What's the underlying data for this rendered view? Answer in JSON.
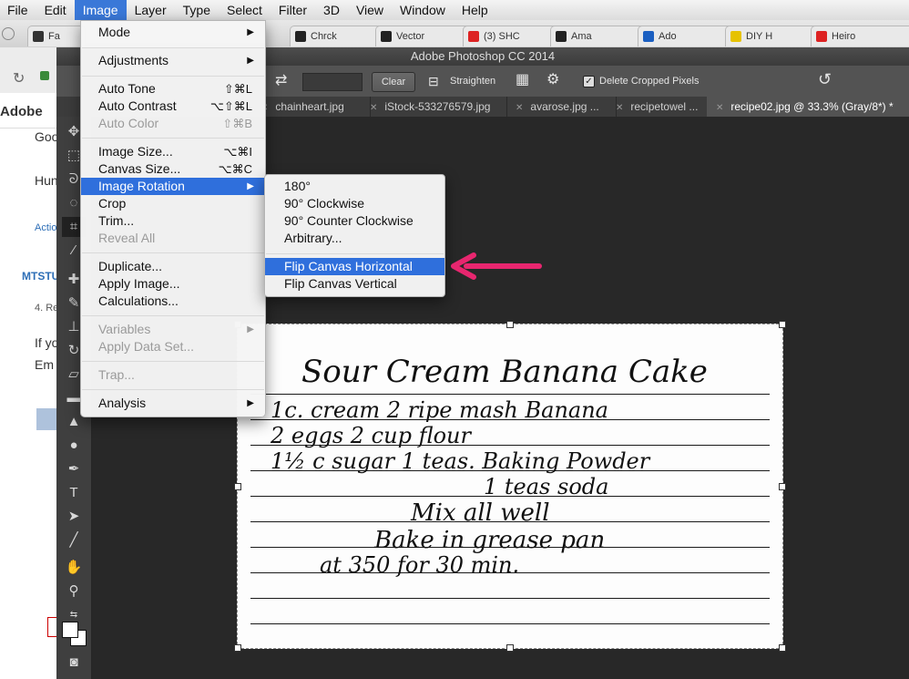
{
  "menubar": {
    "items": [
      "File",
      "Edit",
      "Image",
      "Layer",
      "Type",
      "Select",
      "Filter",
      "3D",
      "View",
      "Window",
      "Help"
    ],
    "active": "Image"
  },
  "browser": {
    "tabs": [
      "Fa",
      "Chrck",
      "Vector",
      "(3) SHC",
      "Ama",
      "Ado",
      "DIY H",
      "Heiro"
    ],
    "sidebar_texts": [
      "Adobe",
      "Goo",
      "Hun",
      "Actio",
      "MTSTU",
      "4. Re",
      "If yo",
      "Em"
    ],
    "accent_color": "#2e6fb7"
  },
  "ps": {
    "window_title": "Adobe Photoshop CC 2014",
    "options": {
      "clear_label": "Clear",
      "straighten_label": "Straighten",
      "delete_cropped_label": "Delete Cropped Pixels",
      "delete_cropped_checked": true
    },
    "tabs": [
      "chainheart.jpg",
      "iStock-533276579.jpg",
      "avarose.jpg ...",
      "recipetowel ...",
      "recipe02.jpg @ 33.3% (Gray/8*) *"
    ],
    "active_tab": "recipe02.jpg @ 33.3% (Gray/8*) *"
  },
  "image_menu": {
    "mode": "Mode",
    "adjustments": "Adjustments",
    "auto_tone": "Auto Tone",
    "auto_tone_sc": "⇧⌘L",
    "auto_contrast": "Auto Contrast",
    "auto_contrast_sc": "⌥⇧⌘L",
    "auto_color": "Auto Color",
    "auto_color_sc": "⇧⌘B",
    "image_size": "Image Size...",
    "image_size_sc": "⌥⌘I",
    "canvas_size": "Canvas Size...",
    "canvas_size_sc": "⌥⌘C",
    "image_rotation": "Image Rotation",
    "crop": "Crop",
    "trim": "Trim...",
    "reveal_all": "Reveal All",
    "duplicate": "Duplicate...",
    "apply_image": "Apply Image...",
    "calculations": "Calculations...",
    "variables": "Variables",
    "apply_data_set": "Apply Data Set...",
    "trap": "Trap...",
    "analysis": "Analysis"
  },
  "rotation_menu": {
    "r180": "180°",
    "cw": "90° Clockwise",
    "ccw": "90° Counter Clockwise",
    "arbitrary": "Arbitrary...",
    "flip_h": "Flip Canvas Horizontal",
    "flip_v": "Flip Canvas Vertical"
  },
  "recipe": {
    "title": "Sour Cream Banana Cake",
    "lines": [
      "1c. cream     2 ripe mash Banana",
      "2 eggs        2 cup flour",
      "1½ c sugar    1 teas. Baking Powder",
      "1 teas soda",
      "Mix all well",
      "Bake in grease pan",
      "at 350   for 30 min."
    ]
  },
  "arrow_color": "#e8266f",
  "highlight_color": "#2f6fdc"
}
